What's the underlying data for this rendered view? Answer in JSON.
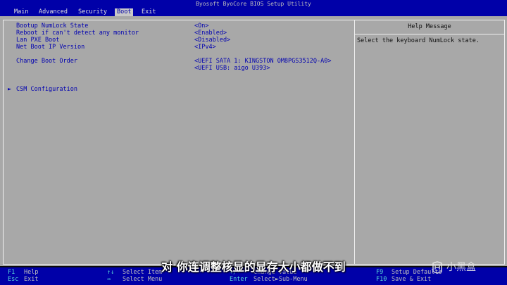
{
  "window": {
    "title": "Byosoft ByoCore BIOS Setup Utility"
  },
  "menu": {
    "tabs": [
      {
        "label": "Main"
      },
      {
        "label": "Advanced"
      },
      {
        "label": "Security"
      },
      {
        "label": "Boot"
      },
      {
        "label": "Exit"
      }
    ],
    "active": "Boot"
  },
  "settings": [
    {
      "label": "Bootup NumLock State",
      "value": "<On>"
    },
    {
      "label": "Reboot if can't detect any monitor",
      "value": "<Enabled>"
    },
    {
      "label": "Lan PXE Boot",
      "value": "<Disabled>"
    },
    {
      "label": "Net Boot IP Version",
      "value": "<IPv4>"
    }
  ],
  "boot_order": {
    "label": "Change Boot Order",
    "entries": [
      "<UEFI SATA 1: KINGSTON OM8PGS3512Q-A0>",
      "<UEFI USB: aigo U393>"
    ]
  },
  "submenu": {
    "arrow": "►",
    "label": "CSM Configuration"
  },
  "help": {
    "title": "Help Message",
    "text": "Select the keyboard NumLock state."
  },
  "footer": {
    "items": [
      {
        "key": "F1",
        "desc": "Help"
      },
      {
        "key": "Esc",
        "desc": "Exit"
      },
      {
        "key": "↑↓",
        "desc": "Select Item"
      },
      {
        "key": "↔",
        "desc": "Select Menu"
      },
      {
        "key": "+/-",
        "desc": "Change Value"
      },
      {
        "key": "Enter",
        "desc": "Select►Sub-Menu"
      },
      {
        "key": "F9",
        "desc": "Setup Defaults"
      },
      {
        "key": "F10",
        "desc": "Save & Exit"
      }
    ]
  },
  "overlay": {
    "subtitle": "对 你连调整核显的显存大小都做不到",
    "watermark": "小黑盒"
  },
  "colors": {
    "bar_blue": "#0000a8",
    "panel_gray": "#a8a8a8",
    "text_blue": "#0000b0",
    "key_cyan": "#58d8d8"
  }
}
